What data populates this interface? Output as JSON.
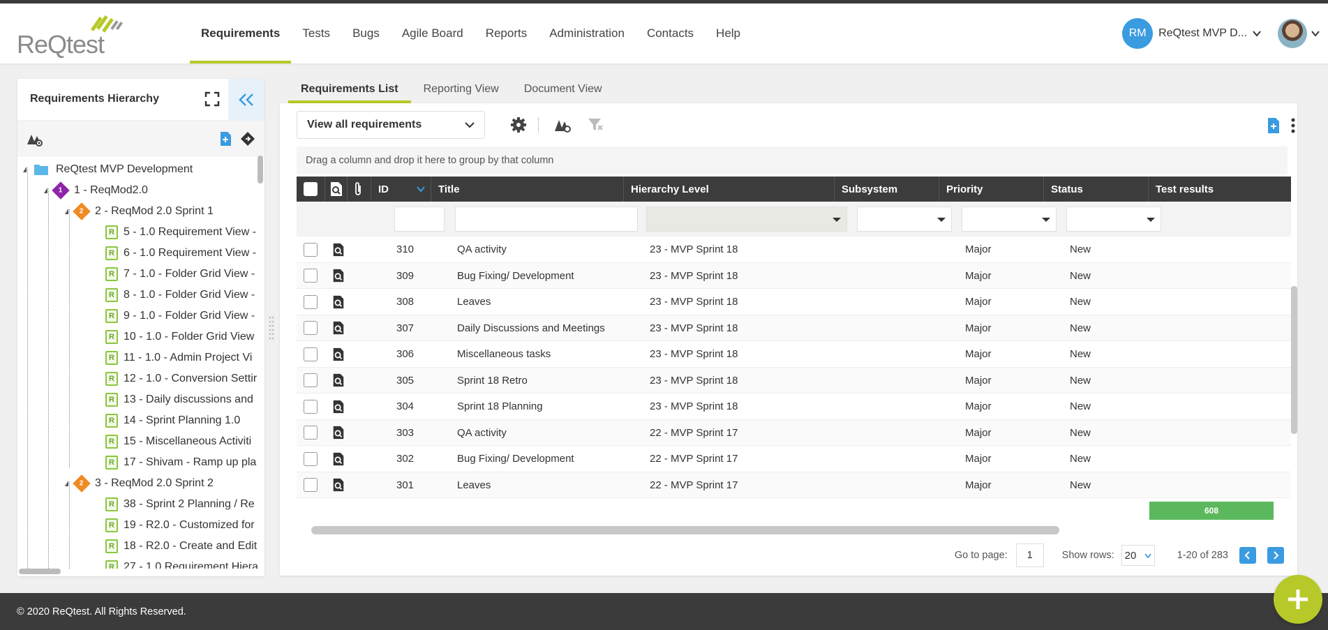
{
  "brand": {
    "logo_text": "ReQtest"
  },
  "nav": {
    "items": [
      {
        "label": "Requirements",
        "active": true
      },
      {
        "label": "Tests"
      },
      {
        "label": "Bugs"
      },
      {
        "label": "Agile Board"
      },
      {
        "label": "Reports"
      },
      {
        "label": "Administration"
      },
      {
        "label": "Contacts"
      },
      {
        "label": "Help"
      }
    ]
  },
  "user": {
    "initials": "RM",
    "project": "ReQtest MVP D..."
  },
  "sidebar": {
    "title": "Requirements Hierarchy",
    "tree": [
      {
        "label": "ReQtest MVP Development",
        "type": "folder"
      },
      {
        "label": "1 - ReqMod2.0",
        "type": "level1",
        "badge": "1"
      },
      {
        "label": "2 - ReqMod 2.0 Sprint 1",
        "type": "level2",
        "badge": "2"
      },
      {
        "label": "5 - 1.0 Requirement View -",
        "type": "req"
      },
      {
        "label": "6 - 1.0 Requirement View -",
        "type": "req"
      },
      {
        "label": "7 - 1.0 - Folder Grid View -",
        "type": "req"
      },
      {
        "label": "8 - 1.0 - Folder Grid View -",
        "type": "req"
      },
      {
        "label": "9 - 1.0 - Folder Grid View -",
        "type": "req"
      },
      {
        "label": "10 - 1.0 - Folder Grid View",
        "type": "req"
      },
      {
        "label": "11 - 1.0 - Admin Project Vi",
        "type": "req"
      },
      {
        "label": "12 - 1.0 - Conversion Settir",
        "type": "req"
      },
      {
        "label": "13 - Daily discussions and",
        "type": "req"
      },
      {
        "label": "14 - Sprint Planning 1.0",
        "type": "req"
      },
      {
        "label": "15 - Miscellaneous Activiti",
        "type": "req"
      },
      {
        "label": "17 - Shivam - Ramp up pla",
        "type": "req"
      },
      {
        "label": "3 - ReqMod 2.0 Sprint 2",
        "type": "level2",
        "badge": "2"
      },
      {
        "label": "38 - Sprint 2 Planning / Re",
        "type": "req"
      },
      {
        "label": "19 - R2.0 - Customized for",
        "type": "req"
      },
      {
        "label": "18 - R2.0 - Create and Edit",
        "type": "req"
      },
      {
        "label": "27 - 1.0 Requirement Hiera",
        "type": "req"
      }
    ]
  },
  "tabs": [
    {
      "label": "Requirements List",
      "active": true
    },
    {
      "label": "Reporting View"
    },
    {
      "label": "Document View"
    }
  ],
  "toolbar": {
    "view_select": "View all requirements"
  },
  "group_hint": "Drag a column and drop it here to group by that column",
  "grid": {
    "columns": [
      "ID",
      "Title",
      "Hierarchy Level",
      "Subsystem",
      "Priority",
      "Status",
      "Test results"
    ],
    "rows": [
      {
        "id": "310",
        "title": "QA activity",
        "level": "23 - MVP Sprint 18",
        "subsystem": "",
        "priority": "Major",
        "status": "New"
      },
      {
        "id": "309",
        "title": "Bug Fixing/ Development",
        "level": "23 - MVP Sprint 18",
        "subsystem": "",
        "priority": "Major",
        "status": "New"
      },
      {
        "id": "308",
        "title": "Leaves",
        "level": "23 - MVP Sprint 18",
        "subsystem": "",
        "priority": "Major",
        "status": "New"
      },
      {
        "id": "307",
        "title": "Daily Discussions and Meetings",
        "level": "23 - MVP Sprint 18",
        "subsystem": "",
        "priority": "Major",
        "status": "New"
      },
      {
        "id": "306",
        "title": "Miscellaneous tasks",
        "level": "23 - MVP Sprint 18",
        "subsystem": "",
        "priority": "Major",
        "status": "New"
      },
      {
        "id": "305",
        "title": "Sprint 18 Retro",
        "level": "23 - MVP Sprint 18",
        "subsystem": "",
        "priority": "Major",
        "status": "New"
      },
      {
        "id": "304",
        "title": "Sprint 18 Planning",
        "level": "23 - MVP Sprint 18",
        "subsystem": "",
        "priority": "Major",
        "status": "New"
      },
      {
        "id": "303",
        "title": "QA activity",
        "level": "22 - MVP Sprint 17",
        "subsystem": "",
        "priority": "Major",
        "status": "New"
      },
      {
        "id": "302",
        "title": "Bug Fixing/ Development",
        "level": "22 - MVP Sprint 17",
        "subsystem": "",
        "priority": "Major",
        "status": "New"
      },
      {
        "id": "301",
        "title": "Leaves",
        "level": "22 - MVP Sprint 17",
        "subsystem": "",
        "priority": "Major",
        "status": "New"
      }
    ],
    "test_results_bar": "608"
  },
  "pager": {
    "goto_label": "Go to page:",
    "page": "1",
    "rows_label": "Show rows:",
    "rows_value": "20",
    "range": "1-20 of 283"
  },
  "footer": {
    "copyright": "© 2020 ReQtest. All Rights Reserved."
  },
  "colors": {
    "accent": "#b7c928",
    "primary": "#3a9be0",
    "header_dark": "#3c3c3c"
  }
}
